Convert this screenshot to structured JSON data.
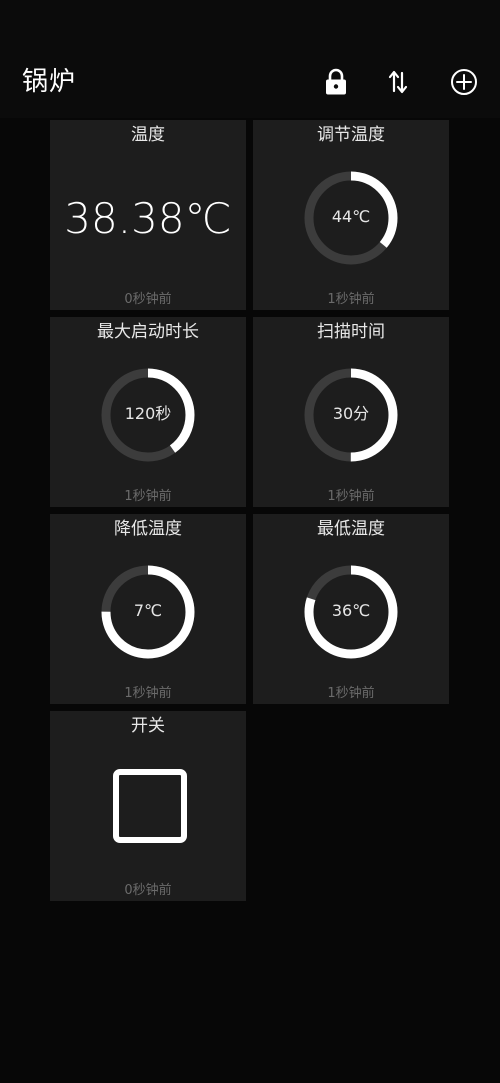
{
  "header": {
    "title": "锅炉"
  },
  "tiles": [
    {
      "label": "温度",
      "value": "38.38℃",
      "time": "0秒钟前",
      "kind": "text"
    },
    {
      "label": "调节温度",
      "value": "44℃",
      "time": "1秒钟前",
      "kind": "ring",
      "fraction": 0.36
    },
    {
      "label": "最大启动时长",
      "value": "120秒",
      "time": "1秒钟前",
      "kind": "ring",
      "fraction": 0.4
    },
    {
      "label": "扫描时间",
      "value": "30分",
      "time": "1秒钟前",
      "kind": "ring",
      "fraction": 0.5
    },
    {
      "label": "降低温度",
      "value": "7℃",
      "time": "1秒钟前",
      "kind": "ring",
      "fraction": 0.75
    },
    {
      "label": "最低温度",
      "value": "36℃",
      "time": "1秒钟前",
      "kind": "ring",
      "fraction": 0.8
    },
    {
      "label": "开关",
      "time": "0秒钟前",
      "kind": "checkbox",
      "checked": false
    }
  ],
  "colors": {
    "background": "#0b0b0b",
    "tile": "#1d1d1d",
    "ring_track": "#3c3c3c",
    "ring_fill": "#ffffff",
    "muted_text": "#6b6b6b"
  }
}
